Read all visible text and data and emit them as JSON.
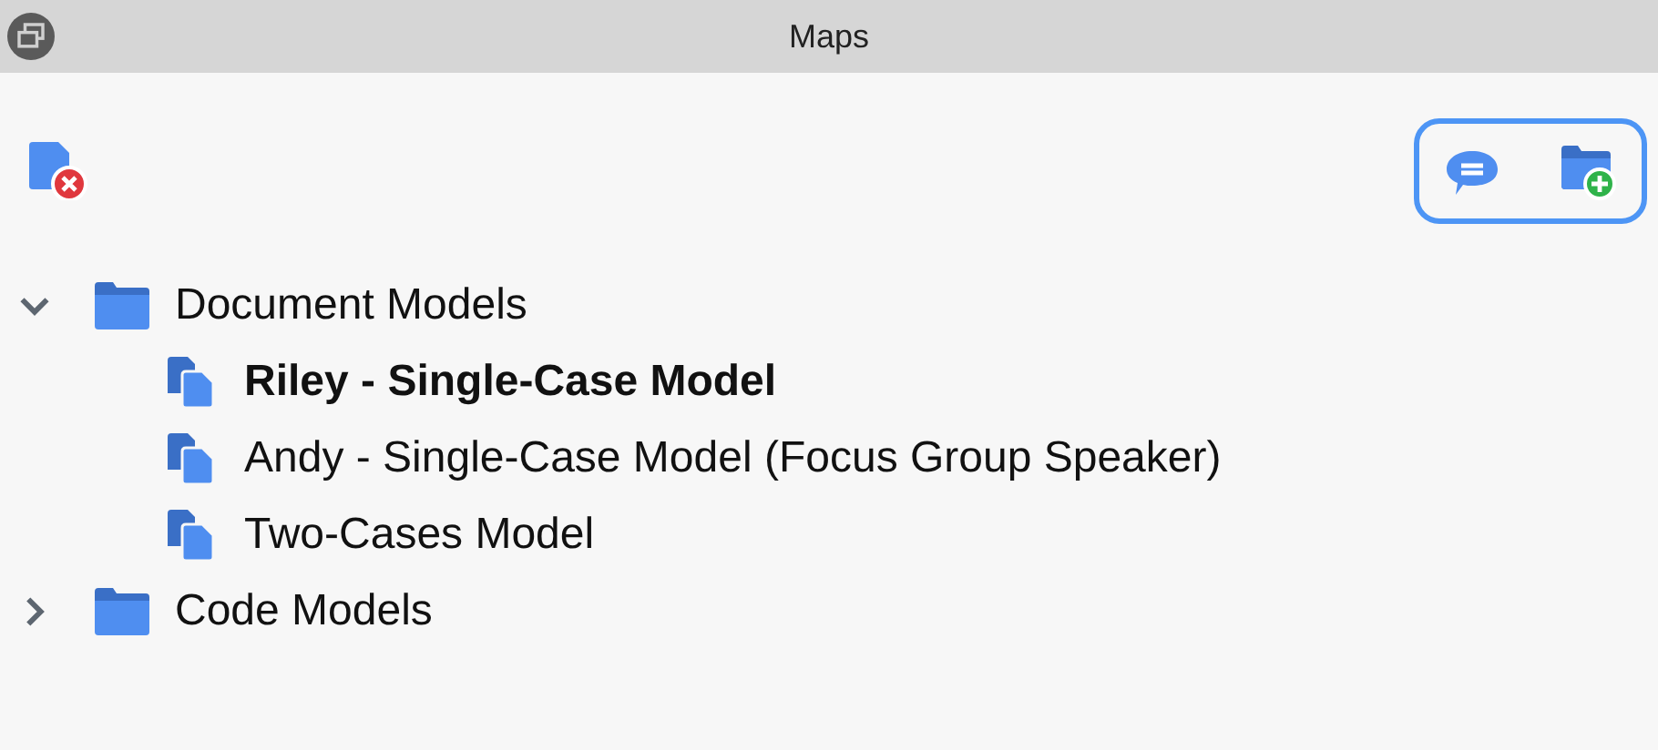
{
  "window": {
    "title": "Maps"
  },
  "toolbar": {
    "focused": true
  },
  "tree": [
    {
      "label": "Document Models",
      "expanded": true,
      "children": [
        {
          "label": "Riley - Single-Case Model",
          "selected": true
        },
        {
          "label": "Andy - Single-Case Model (Focus Group Speaker)",
          "selected": false
        },
        {
          "label": "Two-Cases Model",
          "selected": false
        }
      ]
    },
    {
      "label": "Code Models",
      "expanded": false
    }
  ]
}
